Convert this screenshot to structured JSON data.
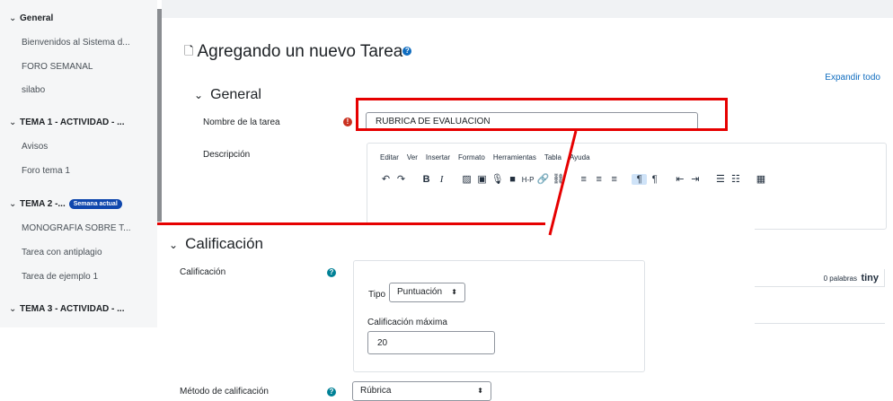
{
  "sidebar": {
    "sections": [
      {
        "label": "General",
        "items": [
          "Bienvenidos al Sistema d...",
          "FORO SEMANAL",
          "silabo"
        ]
      },
      {
        "label": "TEMA 1 - ACTIVIDAD - ...",
        "items": [
          "Avisos",
          "Foro tema 1"
        ]
      },
      {
        "label": "TEMA 2 -...",
        "badge": "Semana actual",
        "items": [
          "MONOGRAFÍA SOBRE T...",
          "Tarea con antiplagio",
          "Tarea de ejemplo 1"
        ]
      },
      {
        "label": "TEMA 3 - ACTIVIDAD - ...",
        "items": []
      }
    ]
  },
  "page": {
    "title": "Agregando un nuevo Tarea",
    "expand_all": "Expandir todo",
    "general_header": "General",
    "name_label": "Nombre de la tarea",
    "name_value": "RUBRICA DE EVALUACION",
    "description_label": "Descripción"
  },
  "editor": {
    "menu": [
      "Editar",
      "Ver",
      "Insertar",
      "Formato",
      "Herramientas",
      "Tabla",
      "Ayuda"
    ],
    "word_count": "0 palabras",
    "brand": "tiny"
  },
  "grading": {
    "header": "Calificación",
    "label": "Calificación",
    "type_label": "Tipo",
    "type_value": "Puntuación",
    "max_label": "Calificación máxima",
    "max_value": "20",
    "method_label": "Método de calificación",
    "method_value": "Rúbrica"
  },
  "colors": {
    "accent": "#0f6cbf",
    "annotation": "#e60000",
    "badge": "#0f47ad"
  }
}
